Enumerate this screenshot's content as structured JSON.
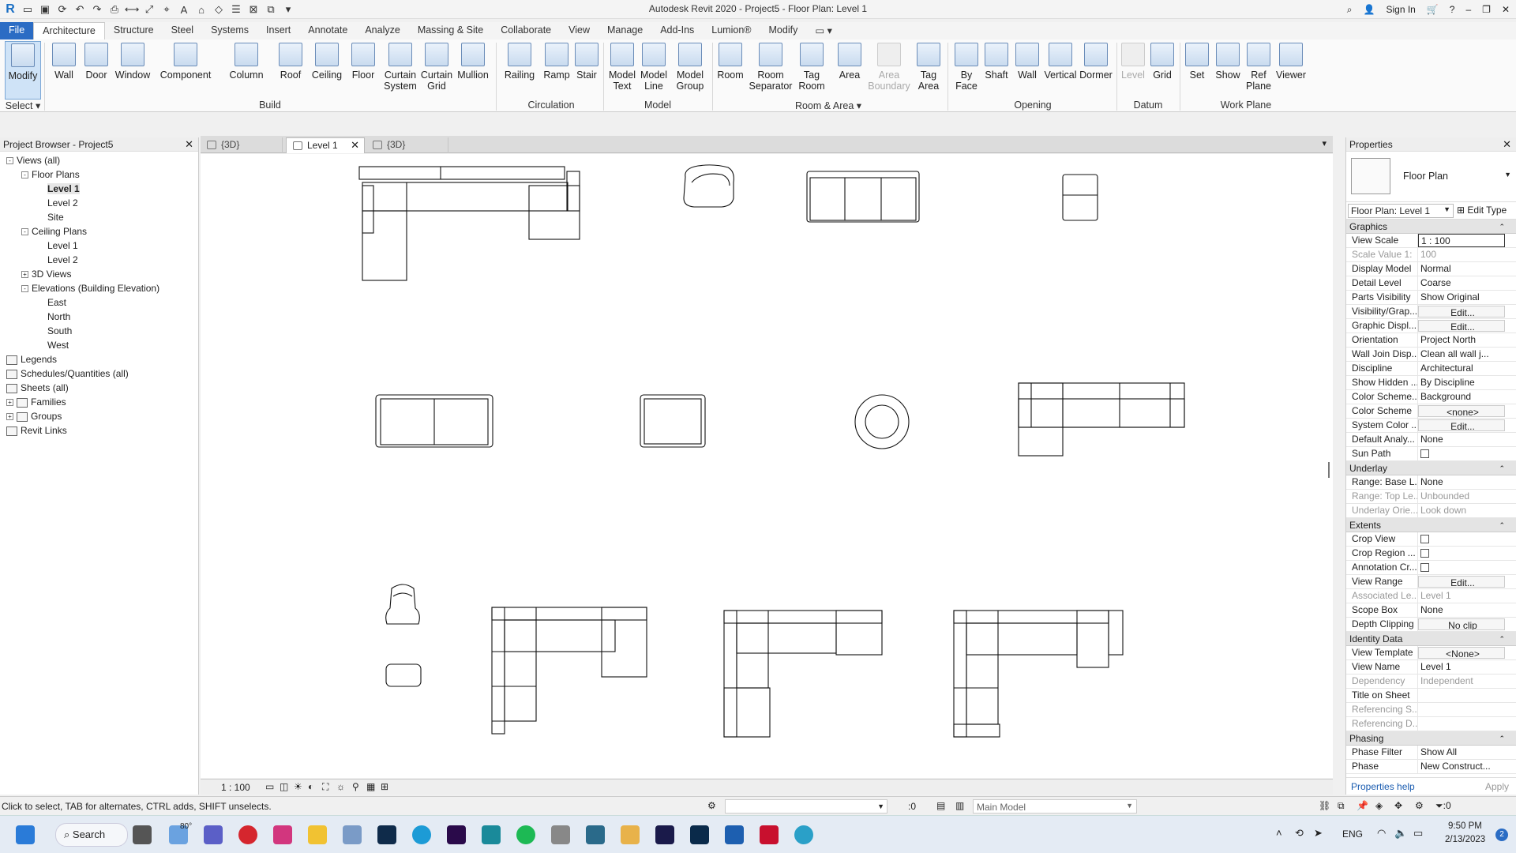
{
  "app": {
    "title": "Autodesk Revit 2020 - Project5 - Floor Plan: Level 1",
    "sign_in": "Sign In"
  },
  "ribbon_tabs": [
    "File",
    "Architecture",
    "Structure",
    "Steel",
    "Systems",
    "Insert",
    "Annotate",
    "Analyze",
    "Massing & Site",
    "Collaborate",
    "View",
    "Manage",
    "Add-Ins",
    "Lumion®",
    "Modify"
  ],
  "ribbon": {
    "select_label": "Select",
    "buttons": {
      "modify": "Modify",
      "wall": "Wall",
      "door": "Door",
      "window": "Window",
      "component": "Component",
      "column": "Column",
      "roof": "Roof",
      "ceiling": "Ceiling",
      "floor": "Floor",
      "curtain_system": "Curtain\nSystem",
      "curtain_grid": "Curtain\nGrid",
      "mullion": "Mullion",
      "railing": "Railing",
      "ramp": "Ramp",
      "stair": "Stair",
      "model_text": "Model\nText",
      "model_line": "Model\nLine",
      "model_group": "Model\nGroup",
      "room": "Room",
      "room_separator": "Room\nSeparator",
      "tag_room": "Tag\nRoom",
      "area": "Area",
      "area_boundary": "Area\nBoundary",
      "tag_area": "Tag\nArea",
      "by_face": "By\nFace",
      "shaft": "Shaft",
      "wall_opening": "Wall",
      "vertical": "Vertical",
      "dormer": "Dormer",
      "level": "Level",
      "grid": "Grid",
      "set": "Set",
      "show": "Show",
      "ref_plane": "Ref\nPlane",
      "viewer": "Viewer"
    },
    "panels": {
      "build": "Build",
      "circulation": "Circulation",
      "model": "Model",
      "room_area": "Room & Area",
      "opening": "Opening",
      "datum": "Datum",
      "work_plane": "Work Plane"
    }
  },
  "project_browser": {
    "title": "Project Browser - Project5",
    "items": [
      {
        "label": "Views (all)",
        "level": 0,
        "exp": "-"
      },
      {
        "label": "Floor Plans",
        "level": 1,
        "exp": "-"
      },
      {
        "label": "Level 1",
        "level": 2,
        "bold": true
      },
      {
        "label": "Level 2",
        "level": 2
      },
      {
        "label": "Site",
        "level": 2
      },
      {
        "label": "Ceiling Plans",
        "level": 1,
        "exp": "-"
      },
      {
        "label": "Level 1",
        "level": 2
      },
      {
        "label": "Level 2",
        "level": 2
      },
      {
        "label": "3D Views",
        "level": 1,
        "exp": "+"
      },
      {
        "label": "Elevations (Building Elevation)",
        "level": 1,
        "exp": "-"
      },
      {
        "label": "East",
        "level": 2
      },
      {
        "label": "North",
        "level": 2
      },
      {
        "label": "South",
        "level": 2
      },
      {
        "label": "West",
        "level": 2
      },
      {
        "label": "Legends",
        "level": 0,
        "icon": true
      },
      {
        "label": "Schedules/Quantities (all)",
        "level": 0,
        "icon": true
      },
      {
        "label": "Sheets (all)",
        "level": 0,
        "icon": true
      },
      {
        "label": "Families",
        "level": 0,
        "exp": "+",
        "icon": true
      },
      {
        "label": "Groups",
        "level": 0,
        "exp": "+",
        "icon": true
      },
      {
        "label": "Revit Links",
        "level": 0,
        "icon": true
      }
    ]
  },
  "view_tabs": [
    {
      "label": "{3D}"
    },
    {
      "label": "Level 1",
      "active": true
    },
    {
      "label": "{3D}"
    }
  ],
  "viewbar": {
    "scale": "1 : 100"
  },
  "properties": {
    "title": "Properties",
    "type_name": "Floor Plan",
    "instance": "Floor Plan: Level 1",
    "edit_type": "Edit Type",
    "groups": [
      {
        "name": "Graphics",
        "rows": [
          {
            "k": "View Scale",
            "v": "1 : 100",
            "kind": "inp"
          },
          {
            "k": "Scale Value    1:",
            "v": "100",
            "ro": true
          },
          {
            "k": "Display Model",
            "v": "Normal"
          },
          {
            "k": "Detail Level",
            "v": "Coarse"
          },
          {
            "k": "Parts Visibility",
            "v": "Show Original"
          },
          {
            "k": "Visibility/Grap...",
            "v": "Edit...",
            "kind": "btn"
          },
          {
            "k": "Graphic Displ...",
            "v": "Edit...",
            "kind": "btn"
          },
          {
            "k": "Orientation",
            "v": "Project North"
          },
          {
            "k": "Wall Join Disp...",
            "v": "Clean all wall j..."
          },
          {
            "k": "Discipline",
            "v": "Architectural"
          },
          {
            "k": "Show Hidden ...",
            "v": "By Discipline"
          },
          {
            "k": "Color Scheme...",
            "v": "Background"
          },
          {
            "k": "Color Scheme",
            "v": "<none>",
            "kind": "btn"
          },
          {
            "k": "System Color ...",
            "v": "Edit...",
            "kind": "btn"
          },
          {
            "k": "Default Analy...",
            "v": "None"
          },
          {
            "k": "Sun Path",
            "v": "",
            "kind": "chk"
          }
        ]
      },
      {
        "name": "Underlay",
        "rows": [
          {
            "k": "Range: Base L...",
            "v": "None"
          },
          {
            "k": "Range: Top Le...",
            "v": "Unbounded",
            "ro": true
          },
          {
            "k": "Underlay Orie...",
            "v": "Look down",
            "ro": true
          }
        ]
      },
      {
        "name": "Extents",
        "rows": [
          {
            "k": "Crop View",
            "v": "",
            "kind": "chk"
          },
          {
            "k": "Crop Region ...",
            "v": "",
            "kind": "chk"
          },
          {
            "k": "Annotation Cr...",
            "v": "",
            "kind": "chk"
          },
          {
            "k": "View Range",
            "v": "Edit...",
            "kind": "btn"
          },
          {
            "k": "Associated Le...",
            "v": "Level 1",
            "ro": true
          },
          {
            "k": "Scope Box",
            "v": "None"
          },
          {
            "k": "Depth Clipping",
            "v": "No clip",
            "kind": "btn"
          }
        ]
      },
      {
        "name": "Identity Data",
        "rows": [
          {
            "k": "View Template",
            "v": "<None>",
            "kind": "btn"
          },
          {
            "k": "View Name",
            "v": "Level 1"
          },
          {
            "k": "Dependency",
            "v": "Independent",
            "ro": true
          },
          {
            "k": "Title on Sheet",
            "v": ""
          },
          {
            "k": "Referencing S...",
            "v": "",
            "ro": true
          },
          {
            "k": "Referencing D...",
            "v": "",
            "ro": true
          }
        ]
      },
      {
        "name": "Phasing",
        "rows": [
          {
            "k": "Phase Filter",
            "v": "Show All"
          },
          {
            "k": "Phase",
            "v": "New Construct..."
          }
        ]
      }
    ],
    "help": "Properties help",
    "apply": "Apply"
  },
  "status": {
    "hint": "Click to select, TAB for alternates, CTRL adds, SHIFT unselects.",
    "model": "Main Model",
    "worksets": ":0",
    "filter": ":0"
  },
  "taskbar": {
    "search": "Search",
    "weather": "80°",
    "lang": "ENG",
    "time": "9:50 PM",
    "date": "2/13/2023",
    "badge": "2"
  }
}
